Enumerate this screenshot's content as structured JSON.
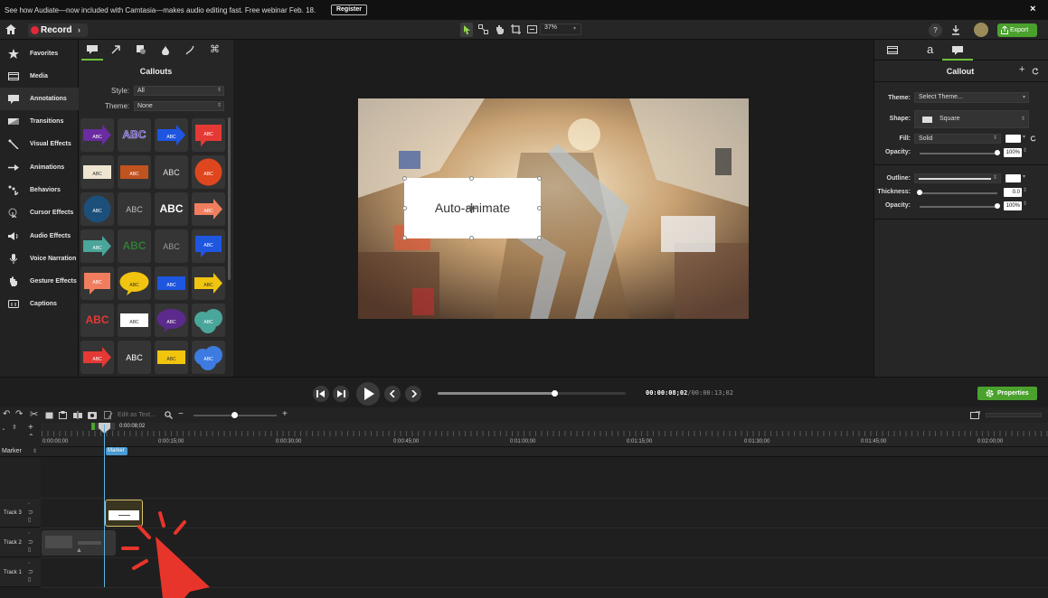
{
  "promo": {
    "text": "See how Audiate—now included with Camtasia—makes audio editing fast. Free webinar Feb. 18.",
    "register_label": "Register",
    "close_glyph": "×"
  },
  "toolbar": {
    "record_label": "Record",
    "zoom_label": "37%",
    "help_glyph": "?",
    "export_label": "Export"
  },
  "sidebar": {
    "items": [
      {
        "label": "Favorites",
        "icon": "star-icon"
      },
      {
        "label": "Media",
        "icon": "film-icon"
      },
      {
        "label": "Annotations",
        "icon": "annotation-icon"
      },
      {
        "label": "Transitions",
        "icon": "transition-icon"
      },
      {
        "label": "Visual Effects",
        "icon": "wand-icon"
      },
      {
        "label": "Animations",
        "icon": "animation-icon"
      },
      {
        "label": "Behaviors",
        "icon": "behavior-icon"
      },
      {
        "label": "Cursor Effects",
        "icon": "cursor-icon"
      },
      {
        "label": "Audio Effects",
        "icon": "speaker-icon"
      },
      {
        "label": "Voice Narration",
        "icon": "microphone-icon"
      },
      {
        "label": "Gesture Effects",
        "icon": "hand-icon"
      },
      {
        "label": "Captions",
        "icon": "captions-icon"
      }
    ]
  },
  "callouts_panel": {
    "title": "Callouts",
    "style_label": "Style:",
    "style_value": "All",
    "theme_label": "Theme:",
    "theme_value": "None",
    "cells": [
      {
        "type": "arrow",
        "color": "#6a2ca0",
        "text": "ABC"
      },
      {
        "type": "outline",
        "color": "#7e57c2",
        "text": "ABC"
      },
      {
        "type": "arrow",
        "color": "#1e56e0",
        "text": "ABC"
      },
      {
        "type": "speech",
        "color": "#e53935",
        "text": "ABC"
      },
      {
        "type": "rect",
        "color": "#efe6d2",
        "text": "ABC"
      },
      {
        "type": "rect",
        "color": "#c1531f",
        "text": "ABC"
      },
      {
        "type": "plain",
        "color": "#e0e0e0",
        "text": "ABC"
      },
      {
        "type": "circle",
        "color": "#e0461e",
        "text": "ABC"
      },
      {
        "type": "circle",
        "color": "#1c4f7a",
        "text": "ABC"
      },
      {
        "type": "plain",
        "color": "#bbbbbb",
        "text": "ABC"
      },
      {
        "type": "bold",
        "color": "#ffffff",
        "text": "ABC"
      },
      {
        "type": "arrow",
        "color": "#f07e5e",
        "text": "ABC"
      },
      {
        "type": "arrow",
        "color": "#4aa59a",
        "text": "ABC"
      },
      {
        "type": "bold",
        "color": "#2e7d32",
        "text": "ABC"
      },
      {
        "type": "plain",
        "color": "#999999",
        "text": "ABC"
      },
      {
        "type": "speech",
        "color": "#1e56e0",
        "text": "ABC"
      },
      {
        "type": "speech",
        "color": "#f07e5e",
        "text": "ABC"
      },
      {
        "type": "ellipse",
        "color": "#f1c40f",
        "text": "ABC"
      },
      {
        "type": "rect",
        "color": "#1e56e0",
        "text": "ABC"
      },
      {
        "type": "arrow",
        "color": "#f1c40f",
        "text": "ABC"
      },
      {
        "type": "bold",
        "color": "#e53935",
        "text": "ABC"
      },
      {
        "type": "rect",
        "color": "#ffffff",
        "text": "ABC"
      },
      {
        "type": "ellipse",
        "color": "#5b2a8c",
        "text": "ABC"
      },
      {
        "type": "cloud",
        "color": "#4aa59a",
        "text": "ABC"
      },
      {
        "type": "arrow",
        "color": "#e53935",
        "text": "ABC"
      },
      {
        "type": "plain",
        "color": "#ffffff",
        "text": "ABC"
      },
      {
        "type": "rect",
        "color": "#f1c40f",
        "text": "ABC"
      },
      {
        "type": "cloud",
        "color": "#3d7be0",
        "text": "ABC"
      }
    ]
  },
  "canvas": {
    "callout_text": "Auto-animate"
  },
  "properties": {
    "title": "Callout",
    "theme_label": "Theme:",
    "theme_value": "Select Theme...",
    "shape_label": "Shape:",
    "shape_value": "Square",
    "fill_label": "Fill:",
    "fill_value": "Solid",
    "opacity_label": "Opacity:",
    "opacity_value": "100%",
    "outline_label": "Outline:",
    "thickness_label": "Thickness:",
    "thickness_value": "0.0",
    "opacity2_label": "Opacity:",
    "opacity2_value": "100%",
    "opacity_fraction": 1.0,
    "thickness_fraction": 0.0
  },
  "playback": {
    "current_time": "00:00:08;02",
    "total_time": "00:00:13;02",
    "progress_fraction": 0.62,
    "properties_label": "Properties"
  },
  "timeline": {
    "edit_as_text_label": "Edit as Text...",
    "playhead_time": "0:00:08;02",
    "ticks": [
      "0:00:00;00",
      "0:00:15;00",
      "0:00:30;00",
      "0:00:45;00",
      "0:01:00;00",
      "0:01:15;00",
      "0:01:30;00",
      "0:01:45;00",
      "0:02:00;00"
    ],
    "marker_row_label": "Marker",
    "marker_label": "Marker",
    "tracks": [
      "Track 3",
      "Track 2",
      "Track 1"
    ]
  },
  "colors": {
    "accent_green": "#4aa22d",
    "record_red": "#e2283b",
    "playhead_blue": "#5bb2e0"
  }
}
